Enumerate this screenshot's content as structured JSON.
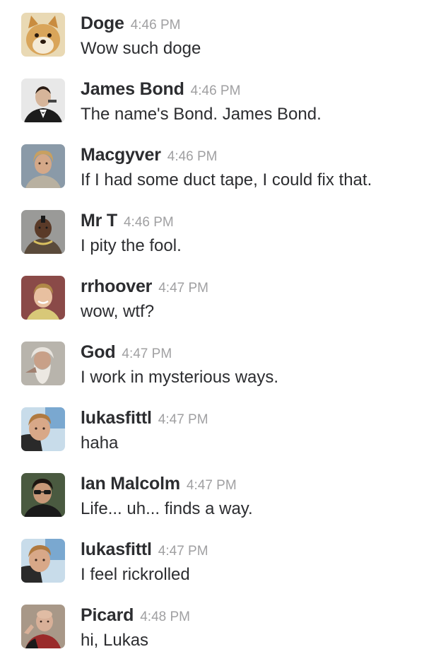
{
  "messages": [
    {
      "author": "Doge",
      "time": "4:46 PM",
      "text": "Wow such doge",
      "avatar": "doge-avatar"
    },
    {
      "author": "James Bond",
      "time": "4:46 PM",
      "text": "The name's Bond. James Bond.",
      "avatar": "james-bond-avatar"
    },
    {
      "author": "Macgyver",
      "time": "4:46 PM",
      "text": "If I had some duct tape, I could fix that.",
      "avatar": "macgyver-avatar"
    },
    {
      "author": "Mr T",
      "time": "4:46 PM",
      "text": "I pity the fool.",
      "avatar": "mr-t-avatar"
    },
    {
      "author": "rrhoover",
      "time": "4:47 PM",
      "text": "wow, wtf?",
      "avatar": "rrhoover-avatar"
    },
    {
      "author": "God",
      "time": "4:47 PM",
      "text": "I work in mysterious ways.",
      "avatar": "god-avatar"
    },
    {
      "author": "lukasfittl",
      "time": "4:47 PM",
      "text": "haha",
      "avatar": "lukasfittl-avatar"
    },
    {
      "author": "Ian Malcolm",
      "time": "4:47 PM",
      "text": "Life... uh... finds a way.",
      "avatar": "ian-malcolm-avatar"
    },
    {
      "author": "lukasfittl",
      "time": "4:47 PM",
      "text": "I feel rickrolled",
      "avatar": "lukasfittl-avatar"
    },
    {
      "author": "Picard",
      "time": "4:48 PM",
      "text": "hi, Lukas",
      "avatar": "picard-avatar"
    }
  ]
}
